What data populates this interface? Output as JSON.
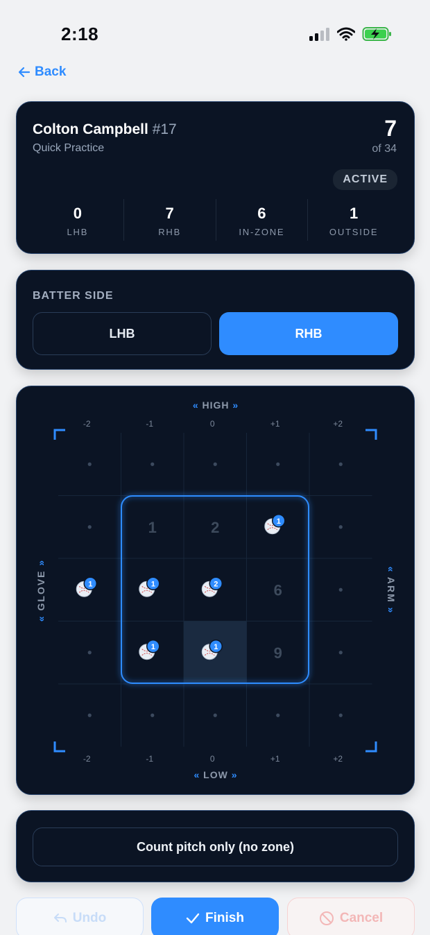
{
  "status_bar": {
    "time": "2:18"
  },
  "nav": {
    "back_label": "Back"
  },
  "player": {
    "name": "Colton Campbell",
    "number": "#17",
    "session": "Quick Practice",
    "pitch_current": "7",
    "pitch_total": "of 34",
    "status": "ACTIVE"
  },
  "stats": [
    {
      "value": "0",
      "label": "LHB"
    },
    {
      "value": "7",
      "label": "RHB"
    },
    {
      "value": "6",
      "label": "IN-ZONE"
    },
    {
      "value": "1",
      "label": "OUTSIDE"
    }
  ],
  "batter_side": {
    "title": "BATTER SIDE",
    "options": [
      "LHB",
      "RHB"
    ],
    "selected": "RHB"
  },
  "zone": {
    "label_top": "HIGH",
    "label_bottom": "LOW",
    "label_left": "GLOVE",
    "label_right": "ARM",
    "axis_ticks": [
      "-2",
      "-1",
      "0",
      "+1",
      "+2"
    ],
    "zone_numbers": {
      "1": "1",
      "2": "2",
      "6": "6",
      "9": "9"
    },
    "pitches": [
      {
        "col": 3,
        "row": 1,
        "count": "1"
      },
      {
        "col": 0,
        "row": 2,
        "count": "1"
      },
      {
        "col": 1,
        "row": 2,
        "count": "1"
      },
      {
        "col": 2,
        "row": 2,
        "count": "2"
      },
      {
        "col": 1,
        "row": 3,
        "count": "1"
      },
      {
        "col": 2,
        "row": 3,
        "count": "1"
      }
    ],
    "highlighted_cell": {
      "col": 2,
      "row": 3
    },
    "accent_color": "#2f8cff"
  },
  "count_only": {
    "label": "Count pitch only (no zone)"
  },
  "actions": {
    "undo": "Undo",
    "finish": "Finish",
    "cancel": "Cancel"
  }
}
